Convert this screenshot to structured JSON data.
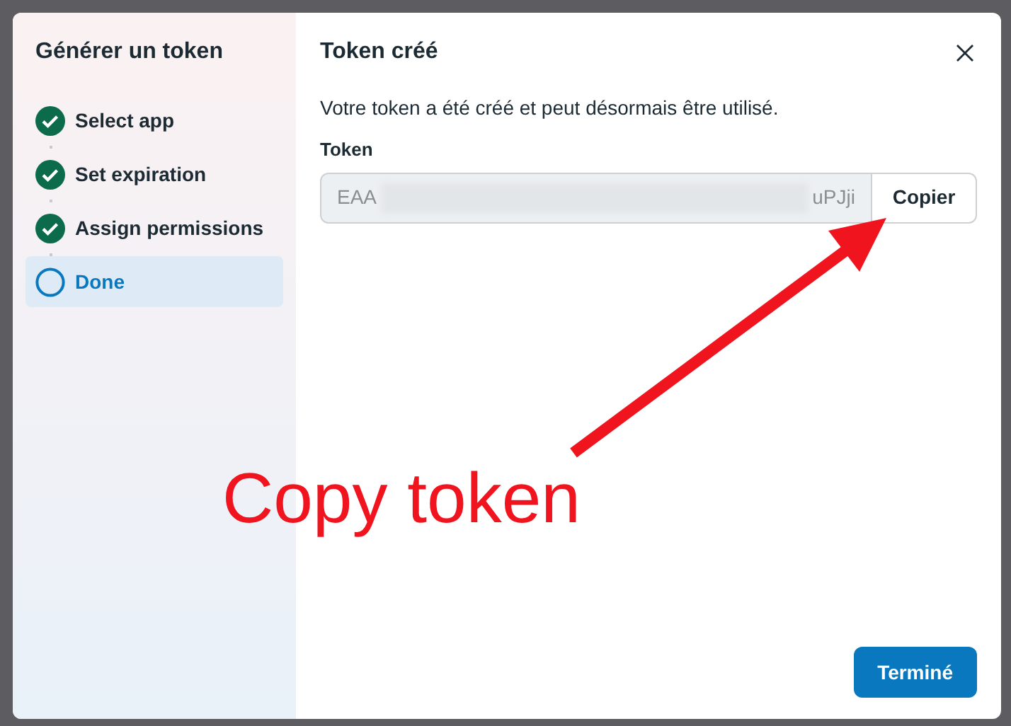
{
  "sidebar": {
    "title": "Générer un token",
    "steps": [
      {
        "label": "Select app",
        "completed": true,
        "selected": false
      },
      {
        "label": "Set expiration",
        "completed": true,
        "selected": false
      },
      {
        "label": "Assign permissions",
        "completed": true,
        "selected": false
      },
      {
        "label": "Done",
        "completed": false,
        "selected": true
      }
    ]
  },
  "dialog": {
    "title": "Token créé",
    "message": "Votre token a été créé et peut désormais être utilisé.",
    "field_label": "Token",
    "token_start": "EAA",
    "token_end": "uPJji",
    "copy_button": "Copier",
    "done_button": "Terminé"
  },
  "annotation": {
    "text": "Copy token"
  }
}
